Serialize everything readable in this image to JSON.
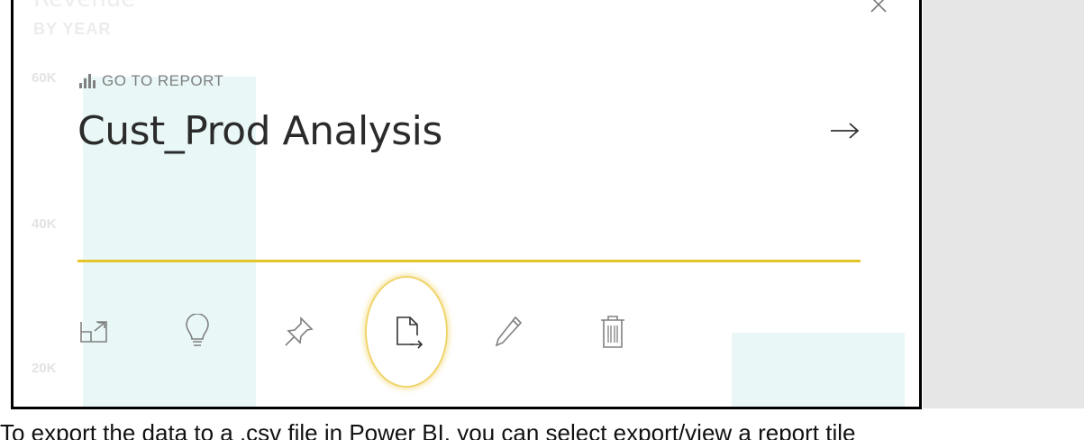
{
  "background_tile": {
    "title": "Revenue",
    "subtitle": "BY YEAR",
    "ticks": [
      "60K",
      "40K",
      "20K"
    ]
  },
  "panel": {
    "goto_label": "GO TO REPORT",
    "report_title": "Cust_Prod Analysis"
  },
  "actions": [
    {
      "name": "focus-mode",
      "icon": "focus-mode-icon"
    },
    {
      "name": "insights",
      "icon": "lightbulb-icon"
    },
    {
      "name": "pin",
      "icon": "pin-icon"
    },
    {
      "name": "export-data",
      "icon": "export-data-icon"
    },
    {
      "name": "edit",
      "icon": "pencil-icon"
    },
    {
      "name": "delete",
      "icon": "trash-icon"
    }
  ],
  "caption": "To export the data to a .csv file in Power BI, you can select export/view a report tile",
  "colors": {
    "accent": "#e3c42b",
    "highlight": "#f0d46a",
    "icon": "#808080",
    "bar": "#e9f7f7"
  }
}
